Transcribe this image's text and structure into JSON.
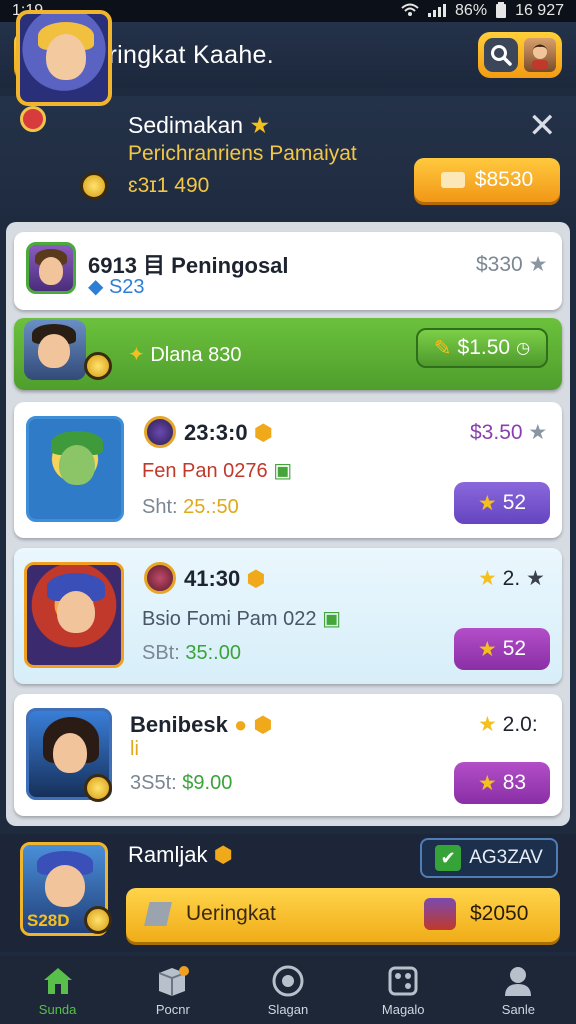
{
  "status_bar": {
    "time": "1:19",
    "battery": "86%",
    "clock": "16 927"
  },
  "app_bar": {
    "title": "Ueringkat Kaahe."
  },
  "featured": {
    "name": "Sedimakan",
    "subtitle": "Perichranriens Pamaiyat",
    "stat": "ɛ3ɪ1 490",
    "price": "$8530"
  },
  "items": [
    {
      "title": "6913 目 Peningosal",
      "sub": "S23",
      "price": "$330"
    },
    {
      "title": "Dlana 830",
      "price": "$1.50"
    },
    {
      "title": "23:3:0",
      "sub": "Fen Pan 0276",
      "stat_label": "Sht:",
      "stat_value": "25.:50",
      "price": "$3.50",
      "button": "52"
    },
    {
      "title": "41:30",
      "sub": "Bsio Fomi Pam 022",
      "stat_label": "SBt:",
      "stat_value": "35:.00",
      "price": "2.",
      "button": "52"
    },
    {
      "title": "Benibesk",
      "sub": "li",
      "stat_label": "3S5t:",
      "stat_value": "$9.00",
      "price": "2.0:",
      "button": "83"
    }
  ],
  "promo": {
    "name": "Ramljak",
    "badge": "AG3ZAV",
    "bar_label": "Ueringkat",
    "bar_price": "$2050",
    "portrait_text": "S28D"
  },
  "nav": [
    {
      "label": "Sunda",
      "icon": "home-icon"
    },
    {
      "label": "Pocnr",
      "icon": "box-icon"
    },
    {
      "label": "Slagan",
      "icon": "circle-icon"
    },
    {
      "label": "Magalo",
      "icon": "dice-icon"
    },
    {
      "label": "Sanle",
      "icon": "person-icon"
    }
  ],
  "colors": {
    "accent": "#f4b322",
    "green": "#5cae33",
    "purple_btn": "#7b54c9",
    "magenta_btn": "#a63fb8",
    "price_purple": "#8a3fb0",
    "stat_gold": "#e0a91a",
    "stat_green": "#3aa33a"
  }
}
